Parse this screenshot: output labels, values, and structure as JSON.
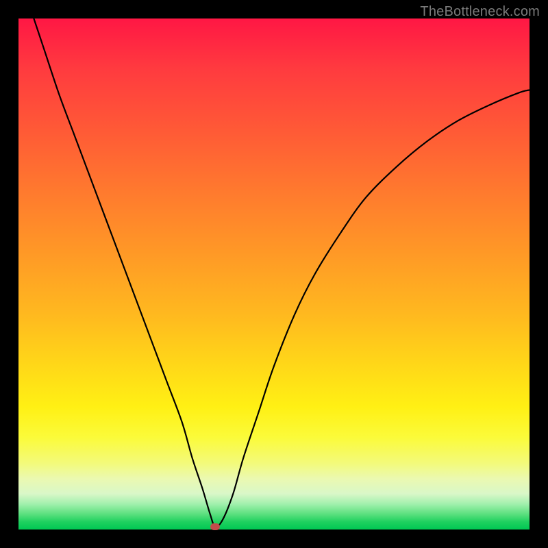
{
  "watermark": "TheBottleneck.com",
  "chart_data": {
    "type": "line",
    "title": "",
    "xlabel": "",
    "ylabel": "",
    "xlim": [
      0,
      100
    ],
    "ylim": [
      0,
      100
    ],
    "grid": false,
    "series": [
      {
        "name": "bottleneck-curve",
        "x": [
          3,
          5,
          8,
          11,
          14,
          17,
          20,
          23,
          26,
          29,
          32,
          34,
          36,
          37.5,
          38.5,
          40,
          42,
          44,
          47,
          50,
          54,
          58,
          63,
          68,
          74,
          80,
          86,
          92,
          98,
          100
        ],
        "values": [
          100,
          94,
          85,
          77,
          69,
          61,
          53,
          45,
          37,
          29,
          21,
          14,
          8,
          3,
          0.5,
          2,
          7,
          14,
          23,
          32,
          42,
          50,
          58,
          65,
          71,
          76,
          80,
          83,
          85.5,
          86
        ]
      }
    ],
    "annotations": [
      {
        "name": "min-marker",
        "x": 38.5,
        "y": 0.5,
        "color": "#c24b4b"
      }
    ],
    "background_gradient": {
      "top": "#ff1744",
      "bottom": "#00c853"
    }
  }
}
